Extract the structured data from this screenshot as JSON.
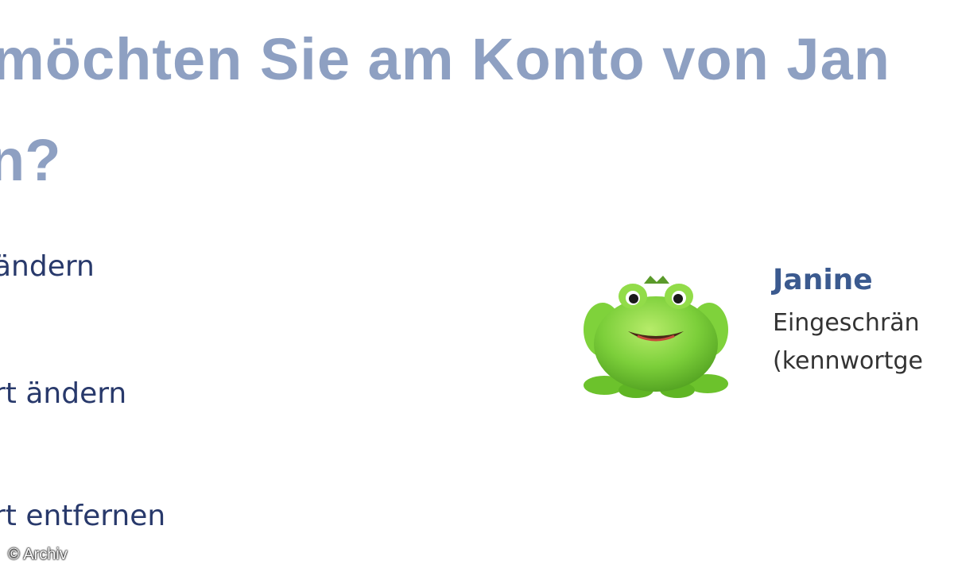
{
  "heading": {
    "line1": "möchten Sie am Konto von Jan",
    "line2": "n?"
  },
  "tasks": [
    {
      "label": "ändern"
    },
    {
      "label": "rt ändern"
    },
    {
      "label": "rt entfernen"
    }
  ],
  "account": {
    "name": "Janine",
    "type": "Eingeschrän",
    "status": "(kennwortge",
    "avatar_icon": "frog-avatar-icon"
  },
  "copyright": "© Archiv",
  "colors": {
    "heading": "#8ea0c2",
    "link": "#28396b",
    "account_name": "#3b5a8f",
    "frog_green": "#7ccf3a"
  }
}
